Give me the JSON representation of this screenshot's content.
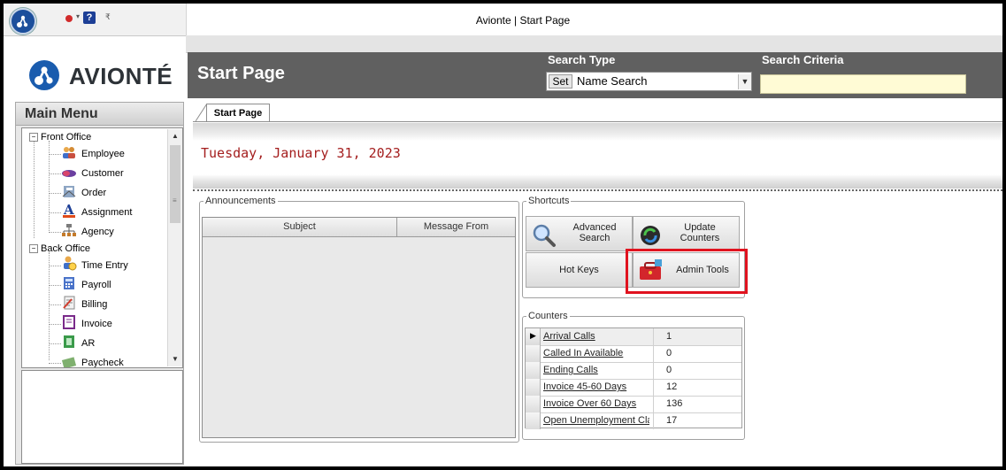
{
  "window": {
    "title": "Avionte | Start Page"
  },
  "brand": {
    "logo_text": "AVIONTÉ"
  },
  "header": {
    "page_title": "Start Page",
    "search_type_label": "Search Type",
    "search_criteria_label": "Search Criteria",
    "set_label": "Set",
    "search_type_value": "Name Search",
    "search_criteria_value": ""
  },
  "main_menu": {
    "title": "Main Menu",
    "groups": [
      {
        "label": "Front Office",
        "items": [
          "Employee",
          "Customer",
          "Order",
          "Assignment",
          "Agency"
        ]
      },
      {
        "label": "Back Office",
        "items": [
          "Time Entry",
          "Payroll",
          "Billing",
          "Invoice",
          "AR",
          "Paycheck"
        ]
      }
    ]
  },
  "tabs": [
    {
      "label": "Start Page"
    }
  ],
  "date": "Tuesday, January 31, 2023",
  "announcements": {
    "legend": "Announcements",
    "columns": [
      "Subject",
      "Message From"
    ]
  },
  "shortcuts": {
    "legend": "Shortcuts",
    "buttons": {
      "advanced_search": "Advanced Search",
      "update_counters": "Update Counters",
      "hot_keys": "Hot Keys",
      "admin_tools": "Admin Tools"
    }
  },
  "counters": {
    "legend": "Counters",
    "rows": [
      {
        "name": "Arrival Calls",
        "value": "1"
      },
      {
        "name": "Called In Available",
        "value": "0"
      },
      {
        "name": "Ending Calls",
        "value": "0"
      },
      {
        "name": "Invoice 45-60 Days",
        "value": "12"
      },
      {
        "name": "Invoice Over 60 Days",
        "value": "136"
      },
      {
        "name": "Open Unemployment Claim",
        "value": "17"
      }
    ]
  },
  "colors": {
    "brand_blue": "#1a5cae",
    "header_gray": "#606060",
    "date_red": "#a41e1e",
    "highlight_red": "#e0131f"
  }
}
